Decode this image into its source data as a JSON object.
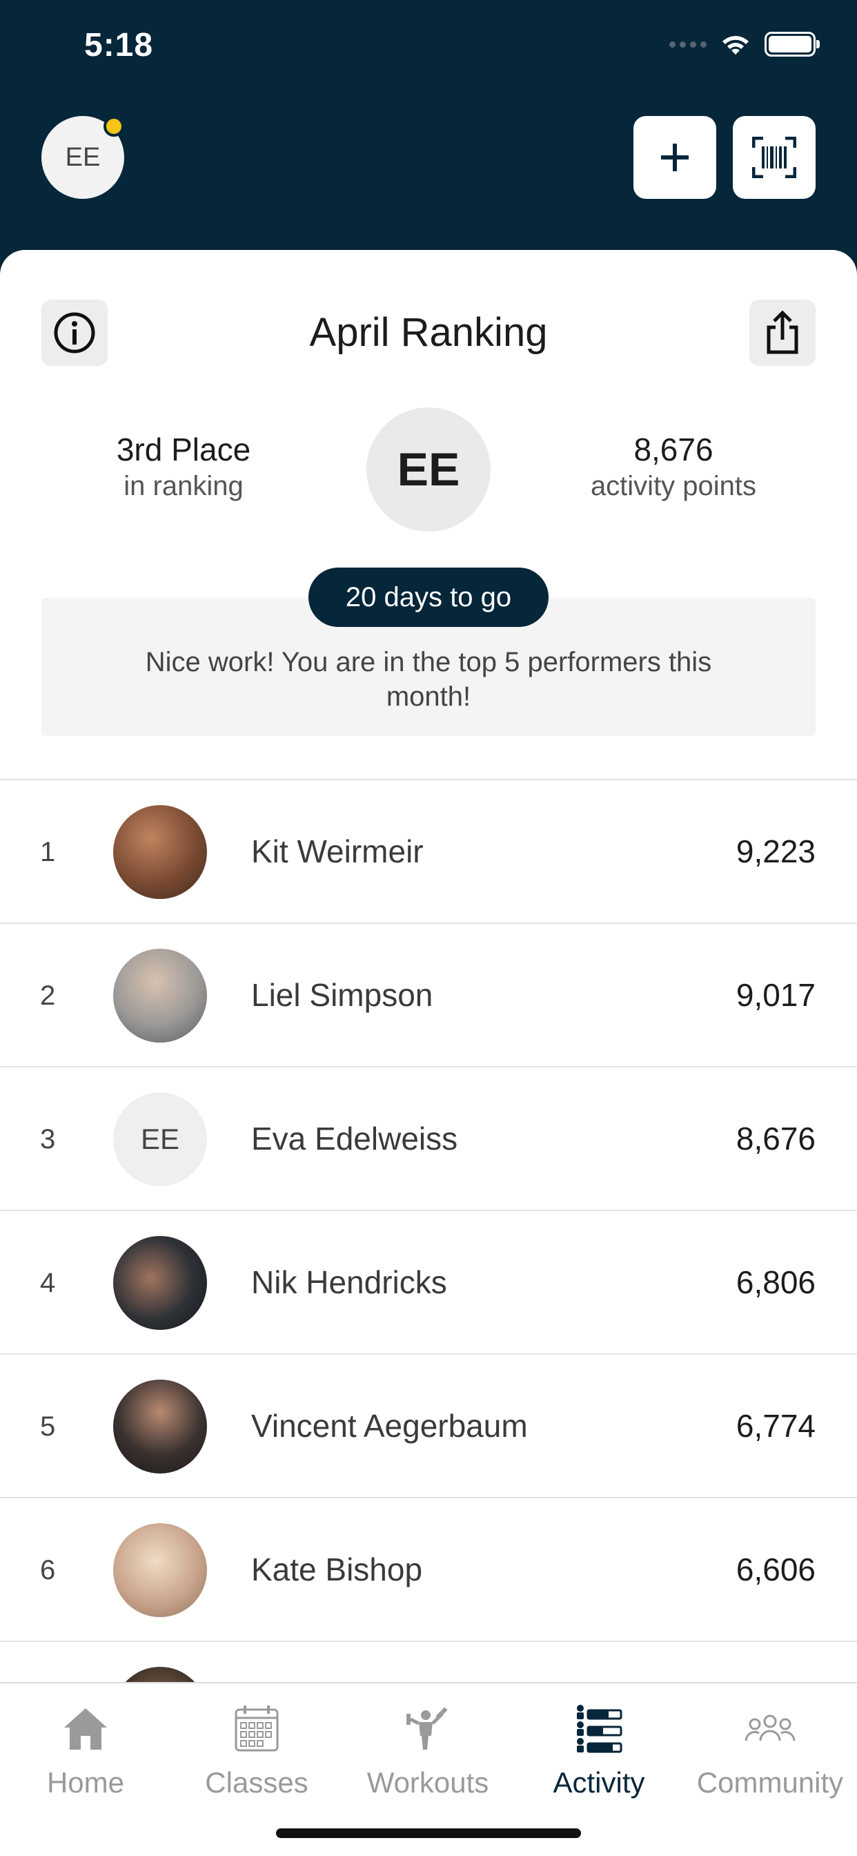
{
  "status_bar": {
    "time": "5:18"
  },
  "header": {
    "user_initials": "EE",
    "add_button": "add",
    "scan_button": "barcode-scan"
  },
  "ranking": {
    "title": "April Ranking",
    "place": "3rd Place",
    "place_sub": "in ranking",
    "avatar_initials": "EE",
    "points": "8,676",
    "points_sub": "activity points",
    "days_pill": "20 days to go",
    "message": "Nice work! You are in the top 5 performers this month!"
  },
  "leaderboard": [
    {
      "rank": "1",
      "name": "Kit Weirmeir",
      "points": "9,223",
      "avatar": "photo",
      "color": "#7a4a32"
    },
    {
      "rank": "2",
      "name": "Liel Simpson",
      "points": "9,017",
      "avatar": "photo",
      "color": "#9a9896"
    },
    {
      "rank": "3",
      "name": "Eva Edelweiss",
      "points": "8,676",
      "avatar": "EE",
      "color": "#efefef"
    },
    {
      "rank": "4",
      "name": "Nik Hendricks",
      "points": "6,806",
      "avatar": "photo",
      "color": "#2e3136"
    },
    {
      "rank": "5",
      "name": "Vincent Aegerbaum",
      "points": "6,774",
      "avatar": "photo",
      "color": "#3a3230"
    },
    {
      "rank": "6",
      "name": "Kate Bishop",
      "points": "6,606",
      "avatar": "photo",
      "color": "#c9a58c"
    }
  ],
  "tabs": [
    {
      "label": "Home",
      "icon": "home-icon",
      "active": false
    },
    {
      "label": "Classes",
      "icon": "calendar-icon",
      "active": false
    },
    {
      "label": "Workouts",
      "icon": "workout-icon",
      "active": false
    },
    {
      "label": "Activity",
      "icon": "activity-list-icon",
      "active": true
    },
    {
      "label": "Community",
      "icon": "community-icon",
      "active": false
    }
  ],
  "colors": {
    "brand_dark": "#06263a",
    "badge_yellow": "#f5c518"
  }
}
